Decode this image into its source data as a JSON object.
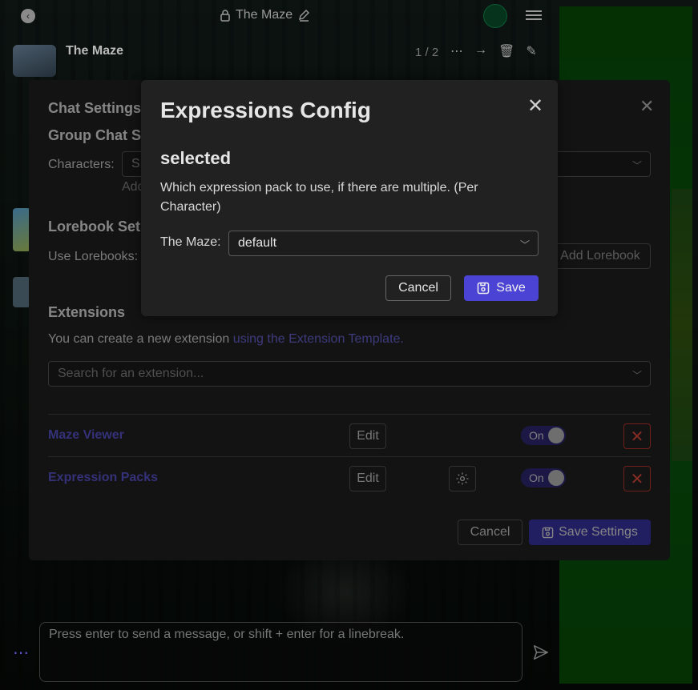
{
  "header": {
    "title": "The Maze"
  },
  "message": {
    "author": "The Maze",
    "counter": "1 / 2"
  },
  "chat_settings": {
    "title": "Chat Settings",
    "group_section": "Group Chat S",
    "characters_label": "Characters",
    "characters_select": "S",
    "add_character": "Add",
    "lorebook_section": "Lorebook Set",
    "use_lorebooks_label": "Use Lorebooks",
    "add_lorebook": "Add Lorebook",
    "extensions_section": "Extensions",
    "extensions_desc": "You can create a new extension ",
    "extensions_link": "using the Extension Template.",
    "search_placeholder": "Search for an extension...",
    "extensions": [
      {
        "name": "Maze Viewer",
        "edit": "Edit",
        "toggle": "On",
        "has_config": false
      },
      {
        "name": "Expression Packs",
        "edit": "Edit",
        "toggle": "On",
        "has_config": true
      }
    ],
    "cancel": "Cancel",
    "save": "Save Settings"
  },
  "expressions_config": {
    "title": "Expressions Config",
    "section": "selected",
    "description": "Which expression pack to use, if there are multiple. (Per Character)",
    "field_label": "The Maze",
    "field_value": "default",
    "cancel": "Cancel",
    "save": "Save"
  },
  "composer": {
    "placeholder": "Press enter to send a message, or shift + enter for a linebreak."
  },
  "colors": {
    "accent": "#4a43d4",
    "danger": "#c0392b",
    "panel": "#212121"
  }
}
